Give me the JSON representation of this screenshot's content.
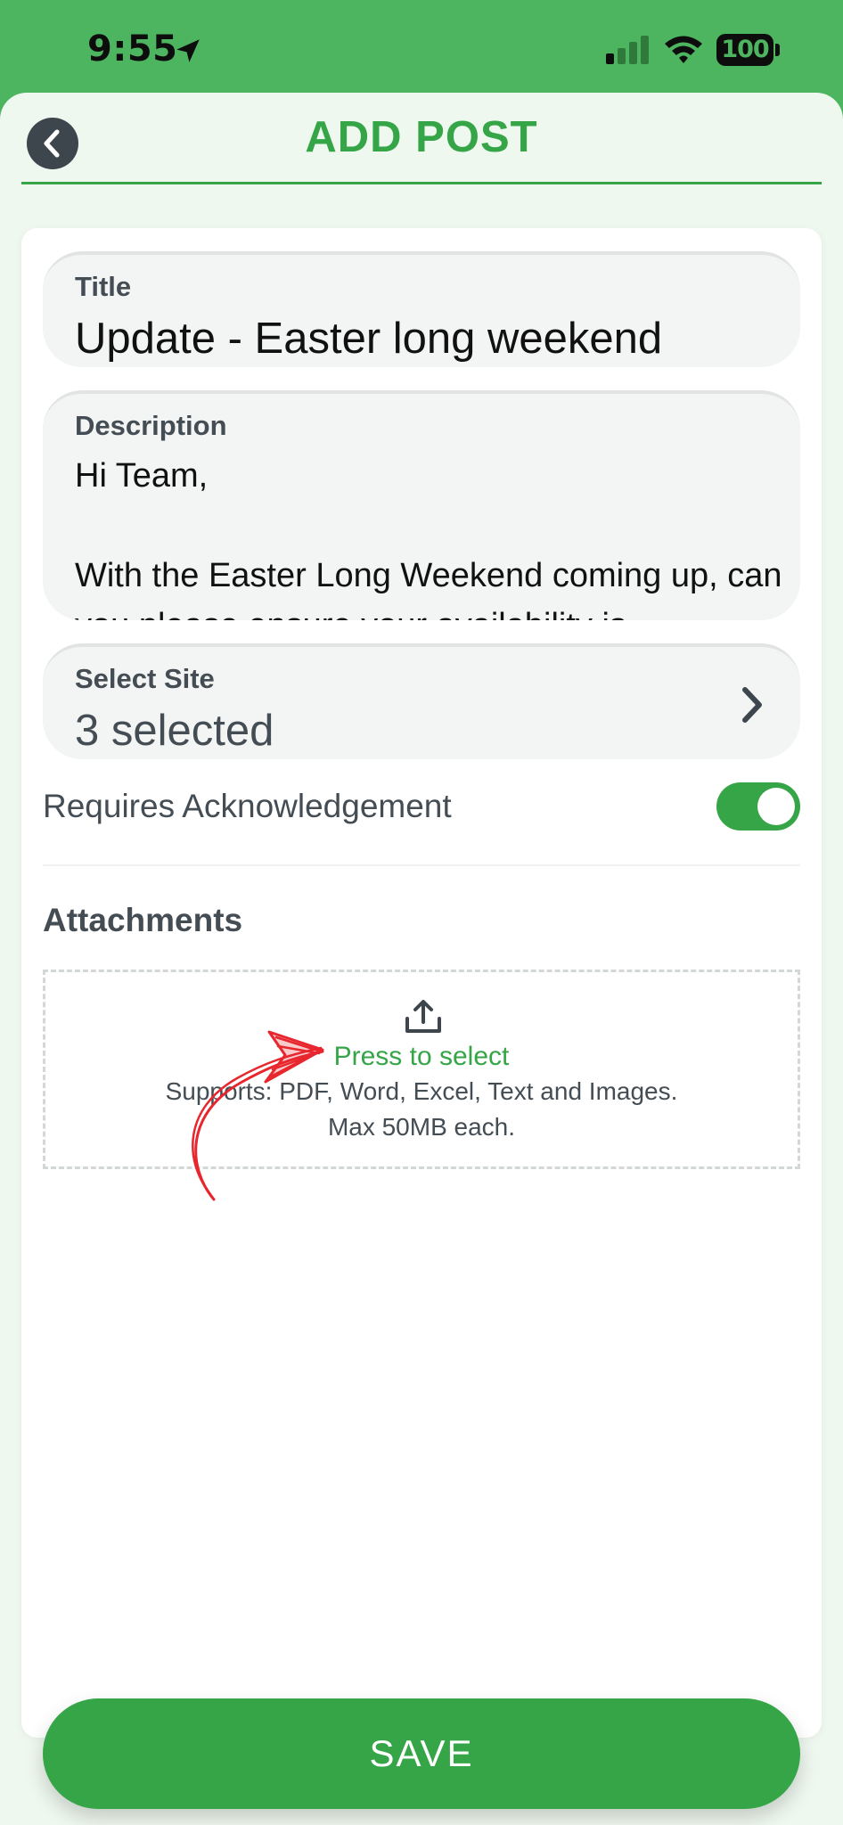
{
  "status_bar": {
    "time": "9:55",
    "battery": "100"
  },
  "header": {
    "title": "ADD POST"
  },
  "form": {
    "title_label": "Title",
    "title_value": "Update - Easter long weekend",
    "description_label": "Description",
    "description_value": "Hi Team,\n\nWith the Easter Long Weekend coming up, can you please ensure your availability is",
    "site_label": "Select Site",
    "site_value": "3 selected",
    "ack_label": "Requires Acknowledgement",
    "ack_enabled": true
  },
  "attachments": {
    "heading": "Attachments",
    "press_label": "Press to select",
    "supports_text": "Supports: PDF, Word, Excel, Text and Images.",
    "max_text": "Max 50MB each."
  },
  "actions": {
    "save_label": "SAVE"
  },
  "colors": {
    "brand_green": "#35a547",
    "status_green": "#4db55f",
    "annotation_red": "#e8262e"
  }
}
